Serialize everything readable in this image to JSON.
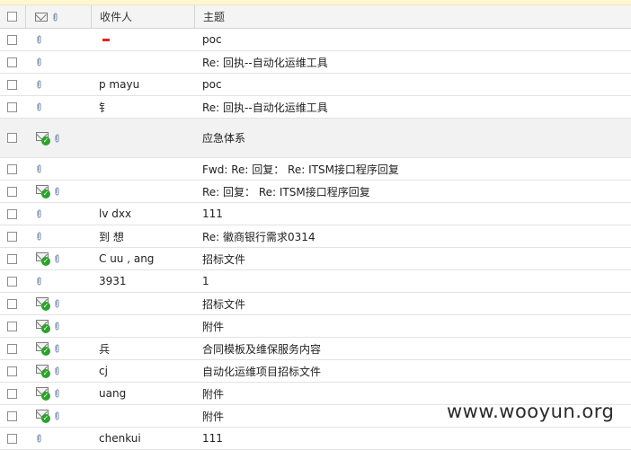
{
  "header": {
    "recipient_label": "收件人",
    "subject_label": "主题"
  },
  "rows": [
    {
      "icons": "clip",
      "recipient": "",
      "subject": "poc",
      "mark": true
    },
    {
      "icons": "clip",
      "recipient": "",
      "subject": "Re: 回执--自动化运维工具"
    },
    {
      "icons": "clip",
      "recipient": "p  mayu",
      "subject": "poc"
    },
    {
      "icons": "clip",
      "recipient": "钅",
      "subject": "Re: 回执--自动化运维工具"
    },
    {
      "icons": "env-clip",
      "recipient": "",
      "subject": "应急体系",
      "tall": true
    },
    {
      "icons": "clip",
      "recipient": "",
      "subject": "Fwd: Re: 回复：  Re: ITSM接口程序回复"
    },
    {
      "icons": "env-clip",
      "recipient": "",
      "subject": "Re: 回复：  Re: ITSM接口程序回复"
    },
    {
      "icons": "clip",
      "recipient": "lv   dxx",
      "subject": "111"
    },
    {
      "icons": "clip",
      "recipient": "到 想",
      "subject": "Re: 徽商银行需求0314"
    },
    {
      "icons": "env-clip",
      "recipient": "C   uu   ,  ang",
      "subject": "招标文件"
    },
    {
      "icons": "clip",
      "recipient": "  3931",
      "subject": "1"
    },
    {
      "icons": "env-clip",
      "recipient": "",
      "subject": "招标文件"
    },
    {
      "icons": "env-clip",
      "recipient": "",
      "subject": "附件"
    },
    {
      "icons": "env-clip",
      "recipient": "  兵",
      "subject": "合同模板及维保服务内容"
    },
    {
      "icons": "env-clip",
      "recipient": "  cj",
      "subject": "自动化运维项目招标文件"
    },
    {
      "icons": "env-clip",
      "recipient": "     uang",
      "subject": "附件"
    },
    {
      "icons": "env-clip",
      "recipient": "",
      "subject": "附件"
    },
    {
      "icons": "clip",
      "recipient": "chenkui",
      "subject": "111"
    }
  ],
  "watermark": "www.wooyun.org",
  "colors": {
    "check_green": "#2ea12c",
    "mark_red": "#e0281c",
    "tall_row_bg": "#f2f2f2"
  }
}
